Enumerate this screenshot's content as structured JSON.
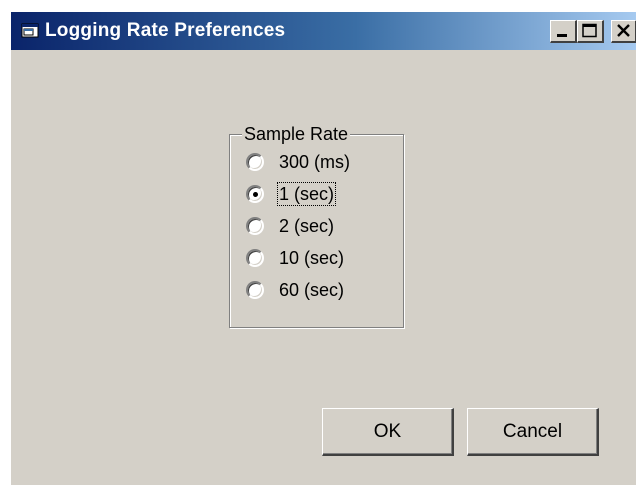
{
  "window": {
    "title": "Logging Rate Preferences",
    "icon": "app-window-icon"
  },
  "titlebar_buttons": {
    "minimize": "minimize-icon",
    "maximize": "maximize-icon",
    "close": "close-icon"
  },
  "sample_rate": {
    "legend": "Sample Rate",
    "options": [
      {
        "label": "300 (ms)",
        "selected": false
      },
      {
        "label": "1 (sec)",
        "selected": true
      },
      {
        "label": "2 (sec)",
        "selected": false
      },
      {
        "label": "10 (sec)",
        "selected": false
      },
      {
        "label": "60 (sec)",
        "selected": false
      }
    ]
  },
  "buttons": {
    "ok": "OK",
    "cancel": "Cancel"
  },
  "colors": {
    "title_gradient_start": "#0a246a",
    "title_gradient_end": "#a6caf0",
    "face": "#d4d0c8"
  }
}
